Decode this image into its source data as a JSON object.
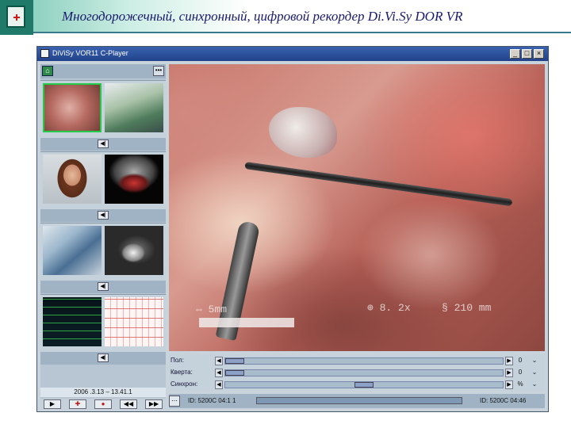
{
  "slide": {
    "title": "Многодорожечный, синхронный, цифровой рекордер Di.Vi.Sy DOR VR"
  },
  "window": {
    "title": "DiViSy VOR11 C-Player",
    "buttons": [
      "_",
      "□",
      "×"
    ]
  },
  "sidebar": {
    "groups": [
      {
        "thumbs": [
          "surgery-close-up",
          "operating-room"
        ],
        "selected": 0
      },
      {
        "thumbs": [
          "presenter-portrait",
          "ultrasound"
        ],
        "selected": null
      },
      {
        "thumbs": [
          "operating-room-staff",
          "x-ray"
        ],
        "selected": null
      },
      {
        "thumbs": [
          "patient-monitor",
          "ecg-chart"
        ],
        "selected": null
      }
    ],
    "timestamp": "2006 .3.13 – 13.41.1",
    "playback_buttons": [
      "▶",
      "✚",
      "●",
      "◀◀",
      "▶▶"
    ]
  },
  "video": {
    "overlay": {
      "distance": "⇔ 5mm",
      "zoom": "⊕ 8. 2x",
      "focal": "§ 210 mm"
    }
  },
  "timeline": {
    "rows": [
      {
        "label": "Пол:",
        "value": "0",
        "thumb_pos": 0.0
      },
      {
        "label": "Кверта:",
        "value": "0",
        "thumb_pos": 0.0
      },
      {
        "label": "Синхрон:",
        "value": "%",
        "thumb_pos": 0.5
      }
    ]
  },
  "status": {
    "left": "ID: 5200C  04:1 1",
    "right": "ID: 5200C  04:46"
  },
  "colors": {
    "accent": "#21428a",
    "selection": "#22cc44",
    "slide_title": "#1a1a6e"
  }
}
